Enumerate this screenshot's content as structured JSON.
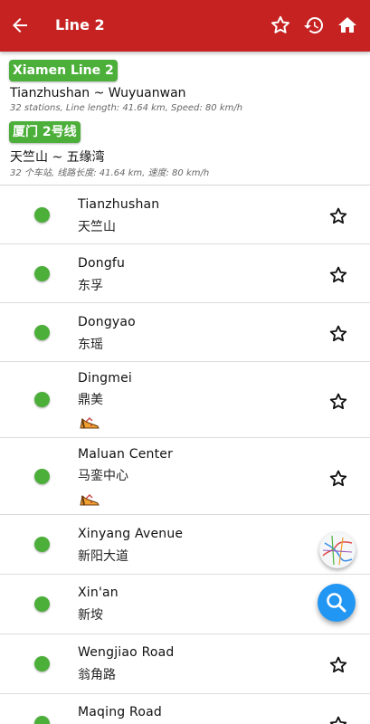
{
  "appbar": {
    "title": "Line 2",
    "back_icon": "arrow-back-icon",
    "actions": [
      "star-outline-icon",
      "history-icon",
      "home-icon"
    ]
  },
  "header": {
    "badge_en": "Xiamen Line 2",
    "route_en": "Tianzhushan ~ Wuyuanwan",
    "meta_en": "32 stations, Line length: 41.64 km, Speed: 80 km/h",
    "badge_cn": "厦门 2号线",
    "route_cn": "天竺山 ~ 五缘湾",
    "meta_cn": "32 个车站, 线路长度: 41.64 km, 速度: 80 km/h",
    "badge_color": "#4caf3a"
  },
  "colors": {
    "appbar": "#c62222",
    "line": "#4caf3a",
    "fab": "#2196f3"
  },
  "stations": [
    {
      "en": "Tianzhushan",
      "cn": "天竺山",
      "tag": false
    },
    {
      "en": "Dongfu",
      "cn": "东孚",
      "tag": false
    },
    {
      "en": "Dongyao",
      "cn": "东瑶",
      "tag": false
    },
    {
      "en": "Dingmei",
      "cn": "鼎美",
      "tag": true
    },
    {
      "en": "Maluan Center",
      "cn": "马銮中心",
      "tag": true
    },
    {
      "en": "Xinyang Avenue",
      "cn": "新阳大道",
      "tag": false
    },
    {
      "en": "Xin'an",
      "cn": "新垵",
      "tag": false
    },
    {
      "en": "Wengjiao Road",
      "cn": "翁角路",
      "tag": false
    },
    {
      "en": "Maqing Road",
      "cn": "",
      "tag": false
    }
  ],
  "fabs": {
    "map_icon": "metro-map-icon",
    "search_icon": "search-icon"
  }
}
